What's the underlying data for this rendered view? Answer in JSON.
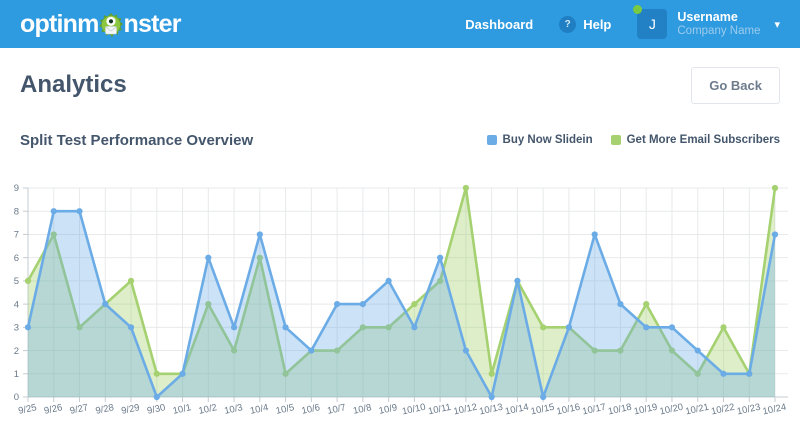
{
  "navbar": {
    "logo_prefix": "optinm",
    "logo_suffix": "nster",
    "dashboard_label": "Dashboard",
    "help_icon": "?",
    "help_label": "Help",
    "avatar_initial": "J",
    "username": "Username",
    "company": "Company Name",
    "chevron_icon": "▾"
  },
  "header": {
    "title": "Analytics",
    "go_back_label": "Go Back"
  },
  "chart_section": {
    "title": "Split Test Performance Overview"
  },
  "chart_data": {
    "type": "area",
    "title": "Split Test Performance Overview",
    "x": [
      "9/25",
      "9/26",
      "9/27",
      "9/28",
      "9/29",
      "9/30",
      "10/1",
      "10/2",
      "10/3",
      "10/4",
      "10/5",
      "10/6",
      "10/7",
      "10/8",
      "10/9",
      "10/10",
      "10/11",
      "10/12",
      "10/13",
      "10/14",
      "10/15",
      "10/16",
      "10/17",
      "10/18",
      "10/19",
      "10/20",
      "10/21",
      "10/22",
      "10/23",
      "10/24"
    ],
    "series": [
      {
        "name": "Buy Now Slidein",
        "color": "#6cace6",
        "fill": "rgba(108,172,230,0.35)",
        "values": [
          3,
          8,
          8,
          4,
          3,
          0,
          1,
          6,
          3,
          7,
          3,
          2,
          4,
          4,
          5,
          3,
          6,
          2,
          0,
          5,
          0,
          3,
          7,
          4,
          3,
          3,
          2,
          1,
          1,
          7
        ]
      },
      {
        "name": "Get More Email Subscribers",
        "color": "#a5d171",
        "fill": "rgba(165,209,113,0.38)",
        "values": [
          5,
          7,
          3,
          4,
          5,
          1,
          1,
          4,
          2,
          6,
          1,
          2,
          2,
          3,
          3,
          4,
          5,
          9,
          1,
          5,
          3,
          3,
          2,
          2,
          4,
          2,
          1,
          3,
          1,
          9
        ]
      }
    ],
    "ylim": [
      0,
      9
    ],
    "yticks": [
      0,
      1,
      2,
      3,
      4,
      5,
      6,
      7,
      8,
      9
    ],
    "grid": true,
    "legend_position": "top-right",
    "xlabel": "",
    "ylabel": ""
  },
  "colors": {
    "navbar_bg": "#2e9be0",
    "heading_text": "#44566c",
    "axis_text": "#6a7a8a",
    "gridline": "#e7e9eb",
    "axis_line": "#c5ccd3",
    "status_dot": "#7ac943"
  }
}
